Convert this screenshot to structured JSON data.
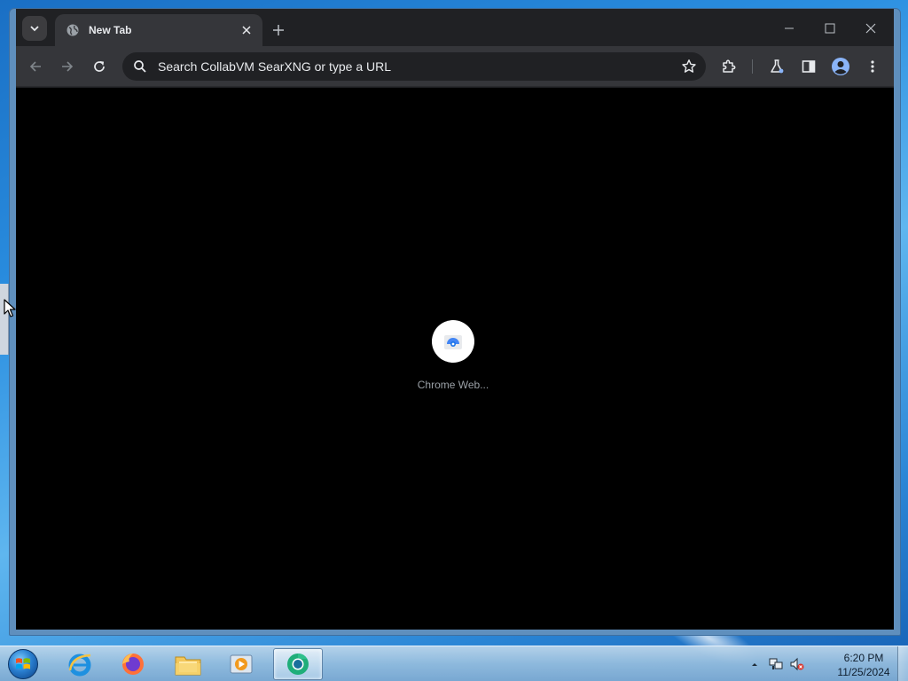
{
  "browser": {
    "tab": {
      "title": "New Tab"
    },
    "omnibox": {
      "placeholder": "Search CollabVM SearXNG or type a URL"
    },
    "shortcut": {
      "label": "Chrome Web..."
    }
  },
  "taskbar": {
    "items": [
      {
        "icon": "internet-explorer-icon"
      },
      {
        "icon": "firefox-icon"
      },
      {
        "icon": "file-explorer-icon"
      },
      {
        "icon": "media-player-icon"
      },
      {
        "icon": "chrome-icon",
        "active": true
      }
    ],
    "clock": {
      "time": "6:20 PM",
      "date": "11/25/2024"
    }
  },
  "colors": {
    "titlebar": "#202124",
    "toolbar": "#35363a",
    "content_bg": "#000000",
    "accent_blue": "#8ab4f8"
  }
}
